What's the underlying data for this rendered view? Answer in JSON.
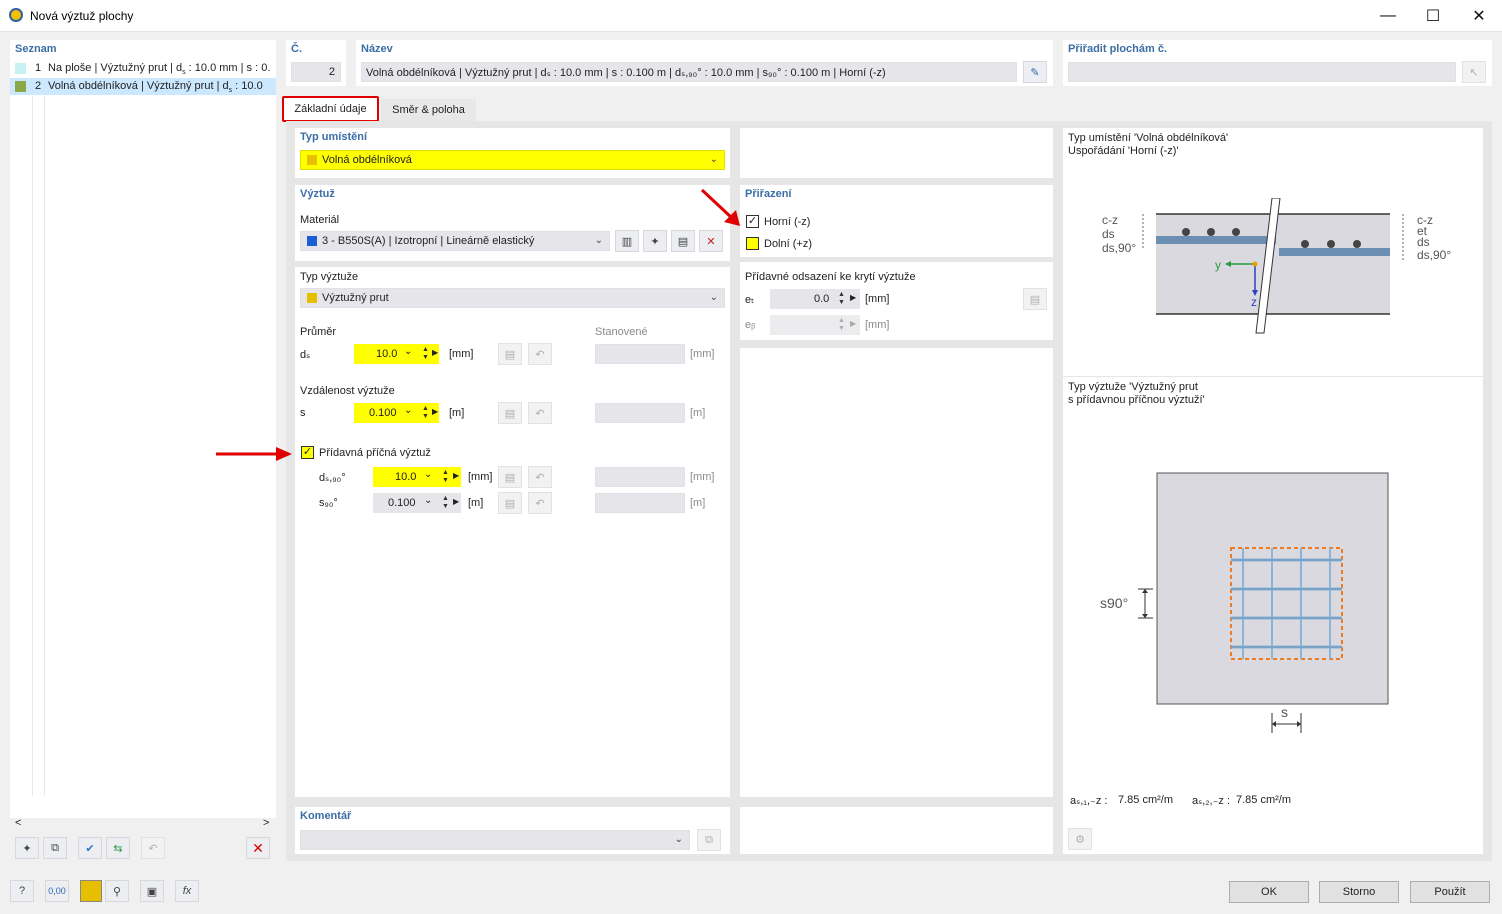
{
  "window": {
    "title": "Nová výztuž plochy",
    "minimize": "—",
    "maximize": "☐",
    "close": "✕"
  },
  "list": {
    "title": "Seznam",
    "items": [
      {
        "num": "1",
        "label": "Na ploše | Výztužný prut | d",
        "sub": "s",
        "tail": " : 10.0 mm | s : 0.",
        "color": "#c6f2f2"
      },
      {
        "num": "2",
        "label": "Volná obdélníková | Výztužný prut | d",
        "sub": "s",
        "tail": " : 10.0",
        "color": "#8aa84a"
      }
    ],
    "scroll_left": "<",
    "scroll_right": ">"
  },
  "header": {
    "num_label": "Č.",
    "num_value": "2",
    "name_label": "Název",
    "name_value": "Volná obdélníková | Výztužný prut | dₛ : 10.0 mm | s : 0.100 m | dₛ,₉₀° : 10.0 mm | s₉₀° : 0.100 m | Horní (-z)",
    "assign_label": "Přiřadit plochám č.",
    "assign_value": ""
  },
  "tabs": [
    {
      "label": "Základní údaje"
    },
    {
      "label": "Směr & poloha"
    }
  ],
  "placement": {
    "title": "Typ umístění",
    "value": "Volná obdélníková",
    "color": "#e6c000"
  },
  "reinforcement": {
    "title": "Výztuž",
    "material_label": "Materiál",
    "material_value": "3 - B550S(A) | Izotropní | Lineárně elastický",
    "material_color": "#1a5fd6",
    "type_label": "Typ výztuže",
    "type_value": "Výztužný prut",
    "type_color": "#e6c000",
    "diameter_label": "Průměr",
    "determined_label": "Stanovené",
    "ds_label": "dₛ",
    "ds_value": "10.0",
    "ds_unit": "[mm]",
    "ds_unit2": "[mm]",
    "spacing_label": "Vzdálenost výztuže",
    "s_label": "s",
    "s_value": "0.100",
    "s_unit": "[m]",
    "s_unit2": "[m]",
    "transverse_label": "Přídavná příčná výztuž",
    "ds90_label": "dₛ,₉₀°",
    "ds90_value": "10.0",
    "ds90_unit": "[mm]",
    "ds90_unit2": "[mm]",
    "s90_label": "s₉₀°",
    "s90_value": "0.100",
    "s90_unit": "[m]",
    "s90_unit2": "[m]"
  },
  "assignment": {
    "title": "Přiřazení",
    "top_label": "Horní (-z)",
    "bottom_label": "Dolní (+z)",
    "offset_title": "Přídavné odsazení ke krytí výztuže",
    "et_label": "eₜ",
    "et_value": "0.0",
    "et_unit": "[mm]",
    "eb_label": "eᵦ",
    "eb_value": "",
    "eb_unit": "[mm]"
  },
  "comment": {
    "title": "Komentář",
    "value": ""
  },
  "preview": {
    "caption1_line1": "Typ umístění 'Volná obdélníková'",
    "caption1_line2": "Uspořádání 'Horní (-z)'",
    "caption2_line1": "Typ výztuže 'Výztužný prut",
    "caption2_line2": "s přídavnou příčnou výztuží'",
    "labels_left": [
      "c-z",
      "ds",
      "ds,90°"
    ],
    "labels_right": [
      "c-z",
      "et",
      "ds",
      "ds,90°"
    ],
    "axis_y": "y",
    "axis_z": "z",
    "s90_label": "s90°",
    "s_label": "s",
    "as1_label": "aₛ,₁,₋z :",
    "as1_value": "7.85 cm²/m",
    "as2_label": "aₛ,₂,₋z :",
    "as2_value": "7.85 cm²/m"
  },
  "buttons": {
    "ok": "OK",
    "cancel": "Storno",
    "apply": "Použít"
  },
  "status": {
    "value_icon": "0,00"
  }
}
